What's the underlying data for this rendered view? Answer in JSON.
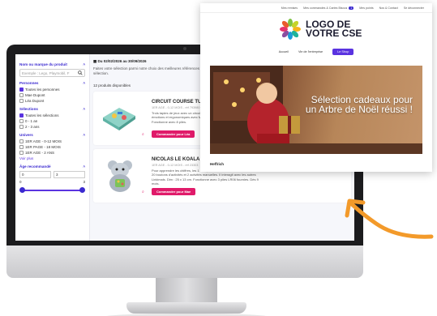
{
  "sidebar": {
    "search_title": "Nom ou marque du produit",
    "search_placeholder": "Exemple : Lego, Playmobil, F",
    "people_title": "Personnes",
    "people_items": [
      {
        "label": "Toutes les personnes",
        "checked": true
      },
      {
        "label": "Mae Dupont",
        "checked": false
      },
      {
        "label": "Léa Dupont",
        "checked": false
      }
    ],
    "selections_title": "Sélections",
    "selections_items": [
      {
        "label": "Toutes les sélections",
        "checked": true
      },
      {
        "label": "0 - 1 an",
        "checked": false
      },
      {
        "label": "2 - 3 ans",
        "checked": false
      }
    ],
    "univers_title": "Univers",
    "univers_items": [
      {
        "label": "1ER AGE - 0-12 MOIS",
        "checked": false
      },
      {
        "label": "1ER PAGE - 18 MOIS",
        "checked": false
      },
      {
        "label": "1ER AGE - 2 ANS",
        "checked": false
      }
    ],
    "voir_plus": "Voir plus",
    "age_title": "Âge recommandé",
    "age_min": "0",
    "age_max": "3",
    "slider_min_label": "0",
    "slider_max_label": "3"
  },
  "main": {
    "date_range": "Du 02/02/2026 au 30/09/2026",
    "intro": "Faites votre sélection parmi notre choix des meilleures références enfant de la plus grands. Attention : vous avez jusqu'au 30/09/2026 pour valider votre sélection.",
    "count": "12 produits disponibles",
    "products": [
      {
        "name": "CIRCUIT COURSE TURBO",
        "meta": "1ER AGE - 0-12 MOIS - réf 793980",
        "desc": "Trois tapies de jeux avec un circuit de course pour voitures. Dimensions et émotions et ergonomiques avec Mare. Il suffit de les fixer Taille 125 x 83 cm. Fonctionne avec 8 piles.",
        "button": "Commander pour Léa"
      },
      {
        "name": "NICOLAS LE KOALA",
        "meta": "1ER AGE - 0-12 MOIS - réf 23303",
        "desc": "Pour apprendre les chiffres, les 1 à 10, les formes avec des sons et lumières. 20 boutons d'activités et 2 activités manuelles. Il interagit avec les autres Linkimals. Dim : 25 x 13 cm. Fonctionne avec 3 piles LR06 fournies. Dès 9 mois.",
        "button": "Commander pour Mae"
      }
    ]
  },
  "overlay": {
    "top_links": [
      "Mes remises",
      "Mes commandes & Cartes Bisous",
      "Mes points",
      "Nos & Contact",
      "Se déconnecter"
    ],
    "cart_badge": "1",
    "logo_line1": "LOGO DE",
    "logo_line2": "VOTRE CSE",
    "nav": [
      "Accueil",
      "Vie de l'entreprise",
      "Le Shop"
    ],
    "hero_text": "Sélection cadeaux pour un Arbre de Noël réussi !",
    "footer_label": "Heffrich"
  },
  "colors": {
    "accent": "#5a33e0",
    "cta": "#e01b6a",
    "arrow": "#f39a2a"
  }
}
